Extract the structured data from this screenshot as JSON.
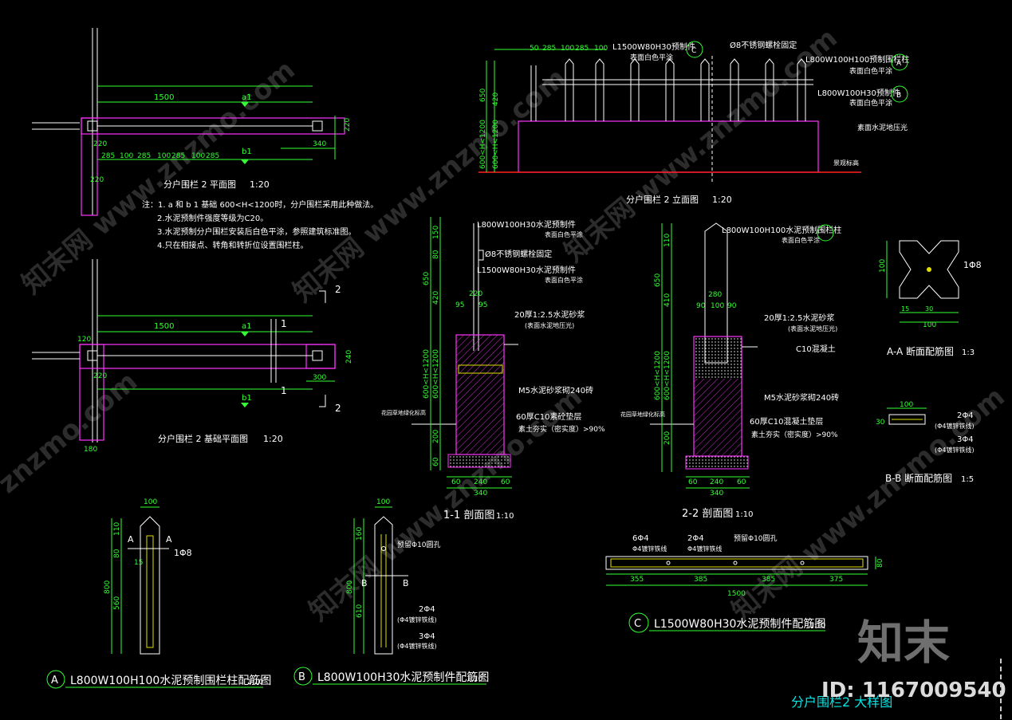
{
  "plan_view": {
    "title": "分户围栏 2 平面图",
    "scale": "1:20",
    "dims": [
      "1500",
      "240",
      "220",
      "220",
      "285",
      "100",
      "285",
      "100",
      "285",
      "100",
      "285",
      "100",
      "340",
      "300",
      "300",
      "60",
      "220"
    ],
    "marks": [
      "a1",
      "b1"
    ]
  },
  "notes": [
    "注：1. a 和 b 1 基础 600<H<1200时，分户围栏采用此种做法。",
    "2.水泥预制件强度等级为C20。",
    "3.水泥预制分户围栏安装后白色平涂，参照建筑标准图。",
    "4.只在相接点、转角和转折位设置围栏柱。"
  ],
  "foundation_plan": {
    "title": "分户围栏 2 基础平面图",
    "scale": "1:20",
    "dims": [
      "1500",
      "120",
      "120",
      "240",
      "220",
      "220",
      "300",
      "240",
      "180",
      "300"
    ],
    "marks": [
      "a1",
      "b1"
    ],
    "section_marks": [
      "1",
      "1",
      "2",
      "2"
    ]
  },
  "elevation": {
    "title": "分户围栏 2 立面图",
    "scale": "1:20",
    "top_dims": [
      "50",
      "285",
      "100",
      "285",
      "100"
    ],
    "labels": {
      "c_label": "L1500W80H30预制件",
      "c_sub": "表面白色平涂",
      "bolt": "Ø8不锈钢螺栓固定",
      "a_label": "L800W100H100预制围栏柱",
      "a_sub": "表面白色平涂",
      "b_label": "L800W100H30预制件",
      "b_sub": "表面白色平涂",
      "ground": "素面水泥地压光",
      "floor": "景观标高"
    },
    "left_dims": [
      "650",
      "420",
      "100",
      "130",
      "80",
      "600<H<1200",
      "600<H<1200"
    ],
    "marks": [
      "C",
      "A",
      "B"
    ]
  },
  "section_1": {
    "title": "1-1 剖面图",
    "scale": "1:10",
    "callouts": [
      "L800W100H30水泥预制件",
      "表面白色平涂",
      "Ø8不锈钢螺栓固定",
      "L1500W80H30水泥预制件",
      "表面白色平涂",
      "20厚1:2.5水泥砂浆",
      "(表面水泥地压光)",
      "M5水泥砂浆砌240砖",
      "60厚C10素砼垫层",
      "素土夯实（密实度）>90%",
      "花园草地绿化标高"
    ],
    "dims": [
      "150",
      "80",
      "650",
      "420",
      "220",
      "95",
      "30",
      "95",
      "150",
      "600<H<1200",
      "600<H<1200",
      "200",
      "60",
      "60",
      "60",
      "60",
      "60",
      "240",
      "60",
      "340"
    ]
  },
  "section_2": {
    "title": "2-2 剖面图",
    "scale": "1:10",
    "callouts": [
      "L800W100H100水泥预制围栏柱",
      "表面白色平涂",
      "20厚1:2.5水泥砂浆",
      "(表面水泥地压光)",
      "C10混凝土",
      "M5水泥砂浆砌240砖",
      "60厚C10混凝土垫层",
      "素土夯实（密实度）>90%",
      "花园草地绿化标高"
    ],
    "dims": [
      "110",
      "60",
      "650",
      "410",
      "280",
      "90",
      "100",
      "90",
      "150",
      "60",
      "600<H<1200",
      "600<H<1200",
      "200",
      "60",
      "120",
      "100",
      "120",
      "60",
      "240",
      "60",
      "340"
    ]
  },
  "section_aa": {
    "title": "A-A 断面配筋图",
    "scale": "1:3",
    "dims": [
      "100",
      "15",
      "10",
      "10",
      "30",
      "10",
      "15",
      "100"
    ],
    "rebar": "1Φ8"
  },
  "section_bb": {
    "title": "B-B 断面配筋图",
    "scale": "1:5",
    "dims": [
      "100",
      "30"
    ],
    "rebar_top": "2Φ4",
    "rebar_top_sub": "(Φ4镀锌铁线)",
    "rebar_bot": "3Φ4",
    "rebar_bot_sub": "(Φ4镀锌铁线)"
  },
  "detail_a": {
    "mark": "A",
    "title": "L800W100H100水泥预制围栏柱配筋图",
    "scale": "1:10",
    "dims": [
      "100",
      "110",
      "80",
      "10",
      "80",
      "800",
      "560",
      "15"
    ],
    "rebar": "1Φ8",
    "section": "A"
  },
  "detail_b": {
    "mark": "B",
    "title": "L800W100H30水泥预制件配筋图",
    "scale": "1:10",
    "dims": [
      "100",
      "160",
      "30",
      "800",
      "610"
    ],
    "hole_label": "预留Φ10圆孔",
    "rebar_1": "2Φ4",
    "rebar_1_sub": "(Φ4镀锌铁线)",
    "rebar_2": "3Φ4",
    "rebar_2_sub": "(Φ4镀锌铁线)",
    "section": "B"
  },
  "detail_c": {
    "mark": "C",
    "title": "L1500W80H30水泥预制件配筋图",
    "scale": "1:10",
    "dims": [
      "355",
      "385",
      "385",
      "375",
      "1500",
      "80"
    ],
    "rebar_1": "6Φ4",
    "rebar_1_sub": "Φ4镀锌铁线",
    "rebar_2": "2Φ4",
    "rebar_2_sub": "Φ4镀锌铁线",
    "hole_label": "预留Φ10圆孔"
  },
  "sheet": {
    "title": "分户围栏2 大样图",
    "brand": "知末",
    "id_label": "ID: 1167009540",
    "watermarks": [
      "知末网 www.znzmo.com",
      "znzmo.com"
    ]
  },
  "colors": {
    "background": "#000000",
    "dimension": "#33ff33",
    "outline": "#ffffff",
    "fill": "#ff33ff",
    "ground_line": "#ff2020",
    "sheet_title": "#00e5e5"
  }
}
